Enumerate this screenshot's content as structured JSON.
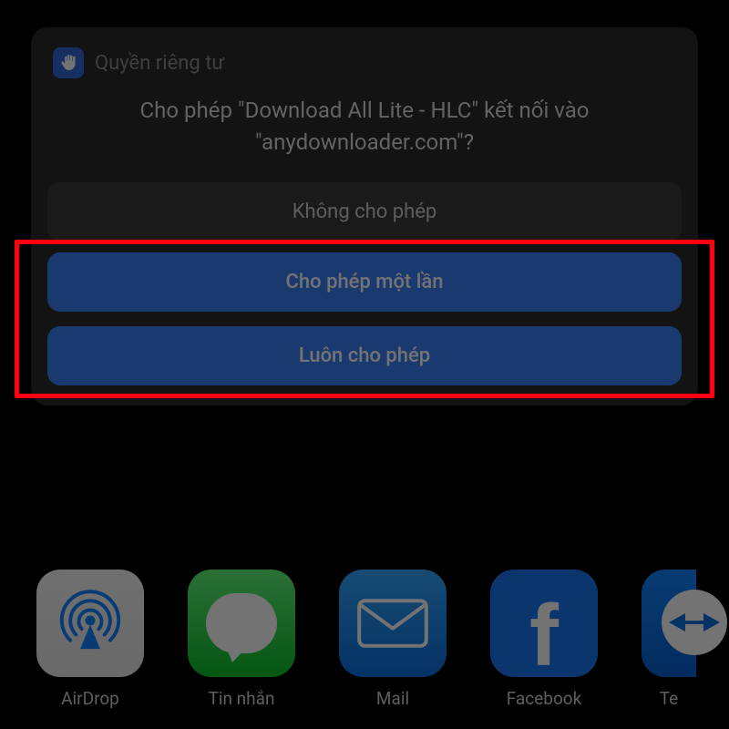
{
  "privacy": {
    "header": "Quyền riêng tư",
    "message": "Cho phép \"Download All Lite - HLC\" kết nối vào \"anydownloader.com\"?",
    "deny_label": "Không cho phép",
    "allow_once_label": "Cho phép một lần",
    "always_allow_label": "Luôn cho phép"
  },
  "share": {
    "items": [
      {
        "label": "AirDrop"
      },
      {
        "label": "Tin nhắn"
      },
      {
        "label": "Mail"
      },
      {
        "label": "Facebook"
      },
      {
        "label_cut": "Te"
      }
    ]
  },
  "colors": {
    "primary_button": "#3b82f6",
    "highlight": "#ff0010"
  }
}
